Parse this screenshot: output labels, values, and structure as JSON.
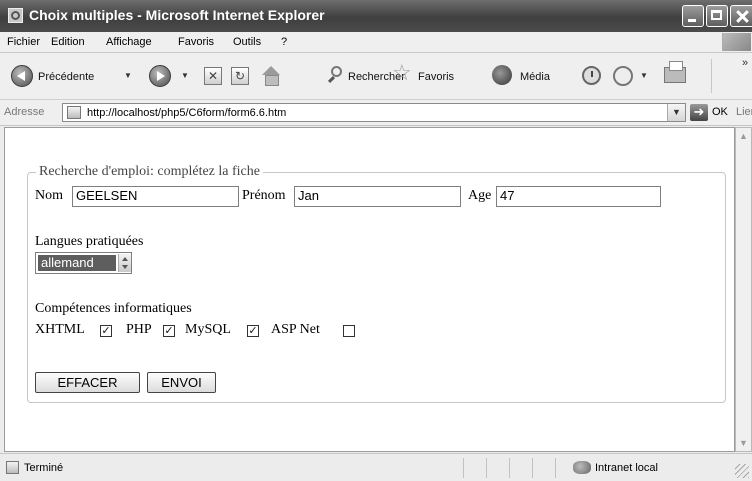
{
  "window": {
    "title": "Choix multiples - Microsoft Internet Explorer"
  },
  "menu": [
    "Fichier",
    "Edition",
    "Affichage",
    "Favoris",
    "Outils",
    "?"
  ],
  "toolbar": {
    "back_label": "Précédente",
    "search_label": "Rechercher",
    "favorites_label": "Favoris",
    "media_label": "Média"
  },
  "address": {
    "label": "Adresse",
    "url": "http://localhost/php5/C6form/form6.6.htm",
    "go_label": "OK",
    "links_label": "Liens"
  },
  "form": {
    "legend": "Recherche d'emploi: complétez la fiche",
    "nom_label": "Nom",
    "nom_value": "GEELSEN",
    "prenom_label": "Prénom",
    "prenom_value": "Jan",
    "age_label": "Age",
    "age_value": "47",
    "langues_label": "Langues pratiquées",
    "langue_selected": "allemand",
    "competences_label": "Compétences informatiques",
    "skills": [
      {
        "label": "XHTML",
        "checked": true
      },
      {
        "label": "PHP",
        "checked": true
      },
      {
        "label": "MySQL",
        "checked": true
      },
      {
        "label": "ASP Net",
        "checked": false
      }
    ],
    "reset_label": "EFFACER",
    "submit_label": "ENVOI"
  },
  "status": {
    "text": "Terminé",
    "zone": "Intranet local"
  }
}
